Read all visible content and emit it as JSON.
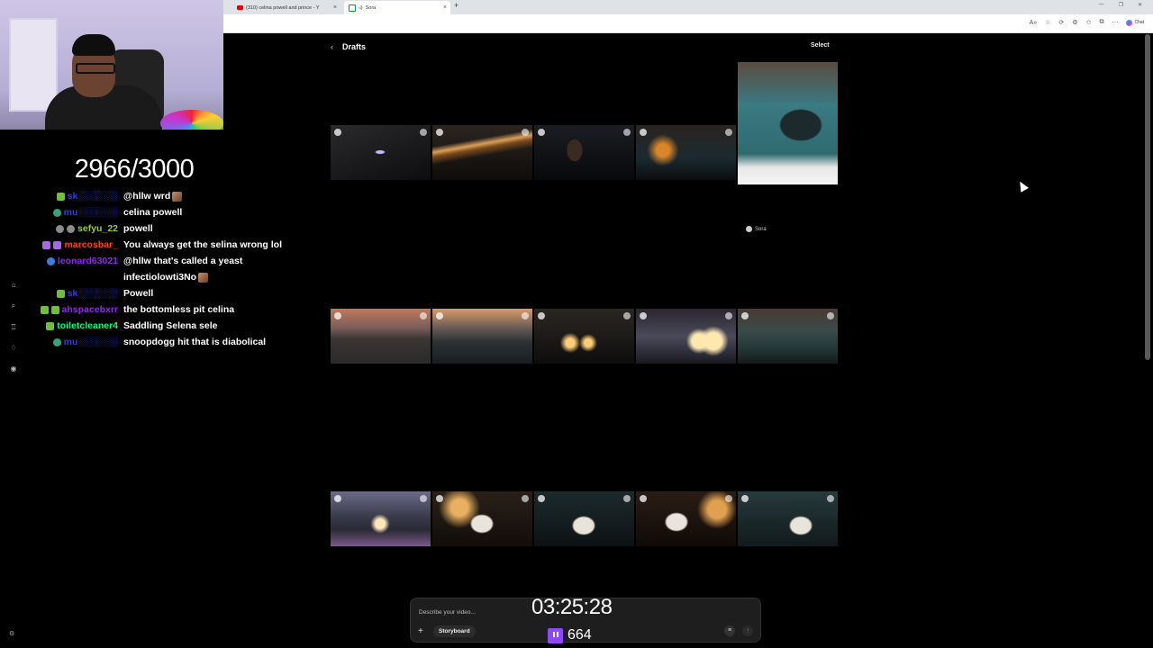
{
  "browser": {
    "tabs": [
      {
        "label": "(310) celina powell and prince - Y",
        "favicon": "youtube-icon"
      },
      {
        "label": "Sora",
        "favicon": "sora-icon"
      }
    ],
    "copilot_label": "Chat",
    "new_tab": "+"
  },
  "stream": {
    "sub_goal": "2966/3000",
    "timer": "03:25:28",
    "viewer_count": "664",
    "chat": [
      {
        "user": "sk░░░░░░",
        "color": "#2b3fd6",
        "badges": [
          "green"
        ],
        "text": "@hllw wrd",
        "emote": true
      },
      {
        "user": "mu░░░░░░",
        "color": "#2b3fd6",
        "badges": [
          "teal"
        ],
        "text": "celina powell",
        "emote": false
      },
      {
        "user": "sefyu_22",
        "color": "#9acd32",
        "badges": [
          "gray",
          "gray"
        ],
        "text": "powell",
        "emote": false
      },
      {
        "user": "marcosbar_",
        "color": "#ff4500",
        "badges": [
          "purple",
          "purple"
        ],
        "text": "You always get the selina wrong lol",
        "emote": false
      },
      {
        "user": "leonard63021",
        "color": "#8a2be2",
        "badges": [
          "blue"
        ],
        "text": "@hllw that's called a yeast infectiolowti3No",
        "emote": true
      },
      {
        "user": "sk░░░░░░",
        "color": "#2b3fd6",
        "badges": [
          "green"
        ],
        "text": "Powell",
        "emote": false
      },
      {
        "user": "ahspacebxrr",
        "color": "#8a2be2",
        "badges": [
          "green",
          "green"
        ],
        "text": "the bottomless pit celina",
        "emote": false
      },
      {
        "user": "toiletcleaner4",
        "color": "#00ff7f",
        "badges": [
          "green"
        ],
        "text": "Saddling Selena sele",
        "emote": false
      },
      {
        "user": "mu░░░░░░",
        "color": "#2b3fd6",
        "badges": [
          "teal"
        ],
        "text": "snoopdogg hit that is diabolical",
        "emote": false
      }
    ]
  },
  "sora": {
    "back_icon": "chevron-left-icon",
    "title": "Drafts",
    "select_label": "Select",
    "watermark": "Sora",
    "composer": {
      "placeholder": "Describe your video...",
      "plus": "+",
      "storyboard": "Storyboard",
      "settings": "≡",
      "send": "↑"
    }
  }
}
